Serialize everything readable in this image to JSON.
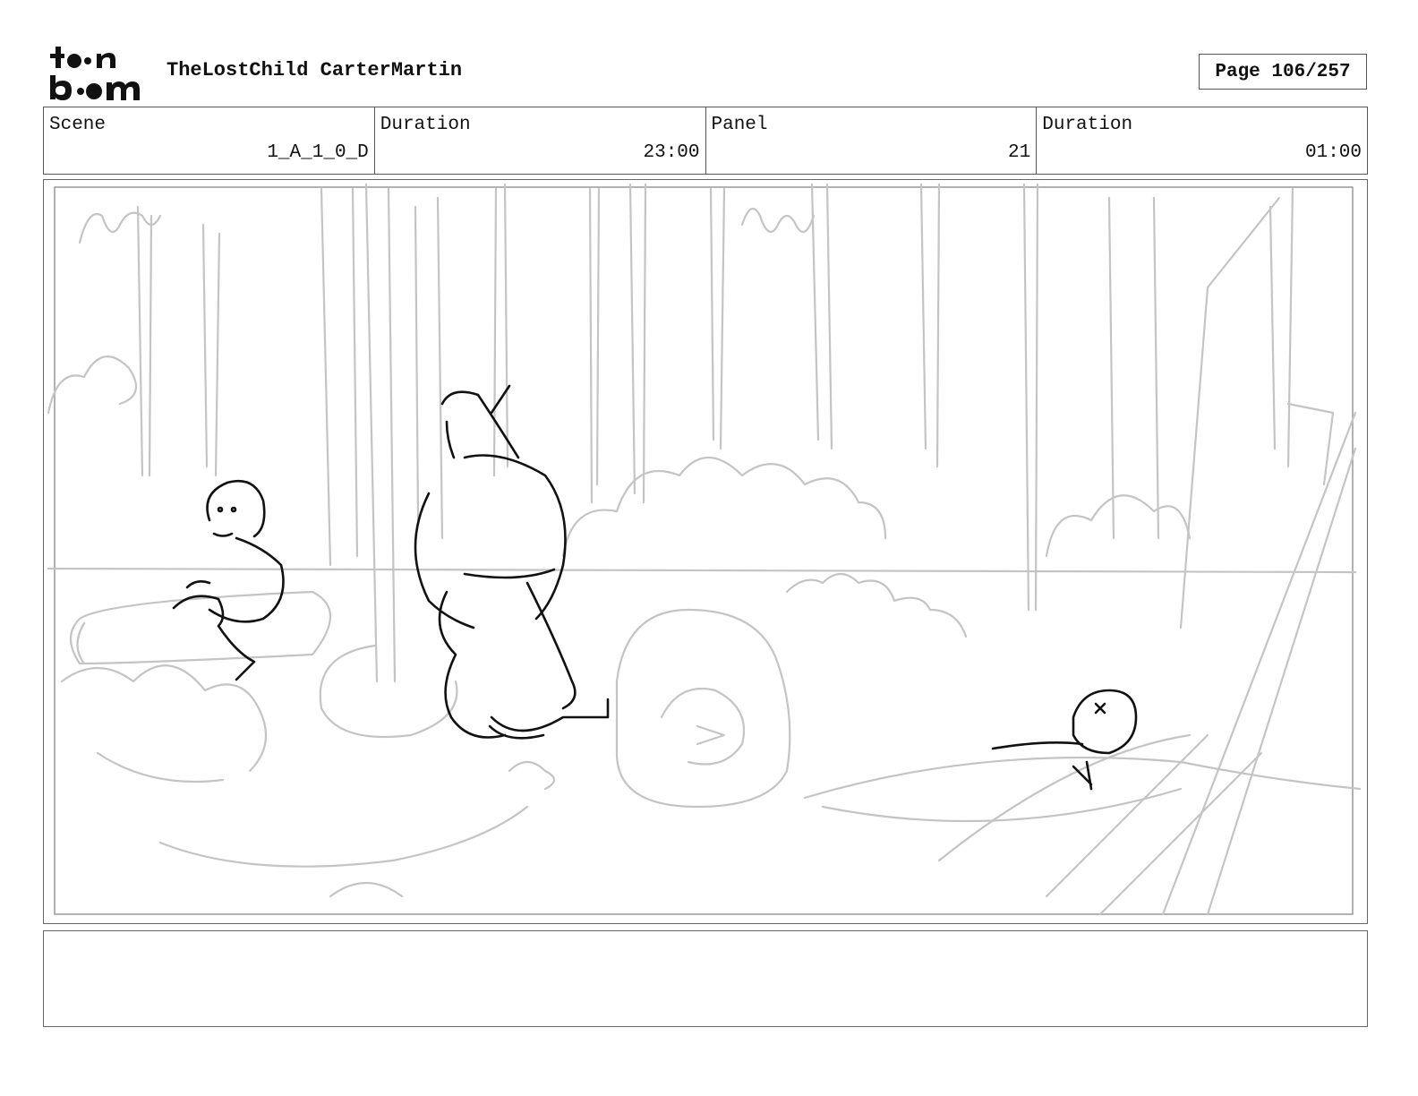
{
  "header": {
    "logo_icon": "toon-boom-logo",
    "title": "TheLostChild CarterMartin",
    "page": "Page 106/257"
  },
  "info": {
    "scene_label": "Scene",
    "scene_value": "1_A_1_0_D",
    "scene_duration_label": "Duration",
    "scene_duration_value": "23:00",
    "panel_label": "Panel",
    "panel_value": "21",
    "panel_duration_label": "Duration",
    "panel_duration_value": "01:00"
  },
  "panel_image": {
    "icon": "storyboard-sketch-forest-scene",
    "sketch_color": "#c4c4c4",
    "ink_color": "#111111"
  },
  "notes": {
    "text": ""
  }
}
